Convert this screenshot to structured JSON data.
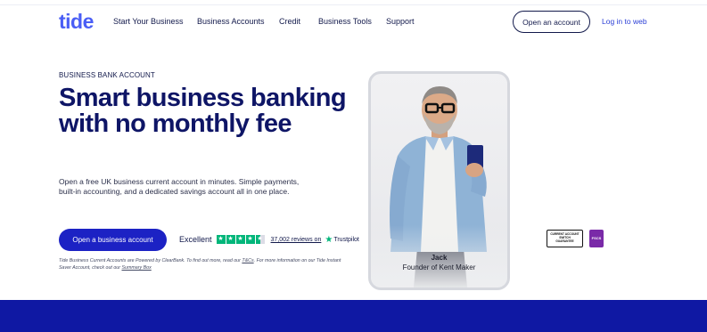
{
  "brand": {
    "logo_text": "tide",
    "accent": "#4a5ef5",
    "primary": "#1c22c4",
    "navy": "#0e1566"
  },
  "nav": {
    "items": [
      "Start Your Business",
      "Business Accounts",
      "Credit",
      "Business Tools",
      "Support"
    ],
    "open_account_label": "Open an account",
    "login_label": "Log in to web"
  },
  "hero": {
    "eyebrow": "BUSINESS BANK ACCOUNT",
    "headline": "Smart business banking with no monthly fee",
    "subtext": "Open a free UK business current account in minutes. Simple payments, built-in accounting, and a dedicated savings account all in one place.",
    "cta_label": "Open a business account",
    "trustpilot": {
      "rating_word": "Excellent",
      "stars": 4.5,
      "reviews_text": "37,002 reviews on",
      "logo_text": "Trustpilot",
      "star_color": "#00b67a"
    },
    "disclaimer": {
      "part1": "Tide Business Current Accounts are Powered by ClearBank. To find out more, read our ",
      "tandc_link": "T&Cs",
      "part2": ". For more information on our Tide Instant Saver Account, check out our ",
      "summary_link": "Summary Box"
    }
  },
  "testimonial": {
    "name": "Jack",
    "role": "Founder of Kent Maker"
  },
  "badges": {
    "switch_line1": "CURRENT ACCOUNT",
    "switch_line2": "SWITCH",
    "switch_line3": "GUARANTEE",
    "fscs_text": "FSCS"
  }
}
